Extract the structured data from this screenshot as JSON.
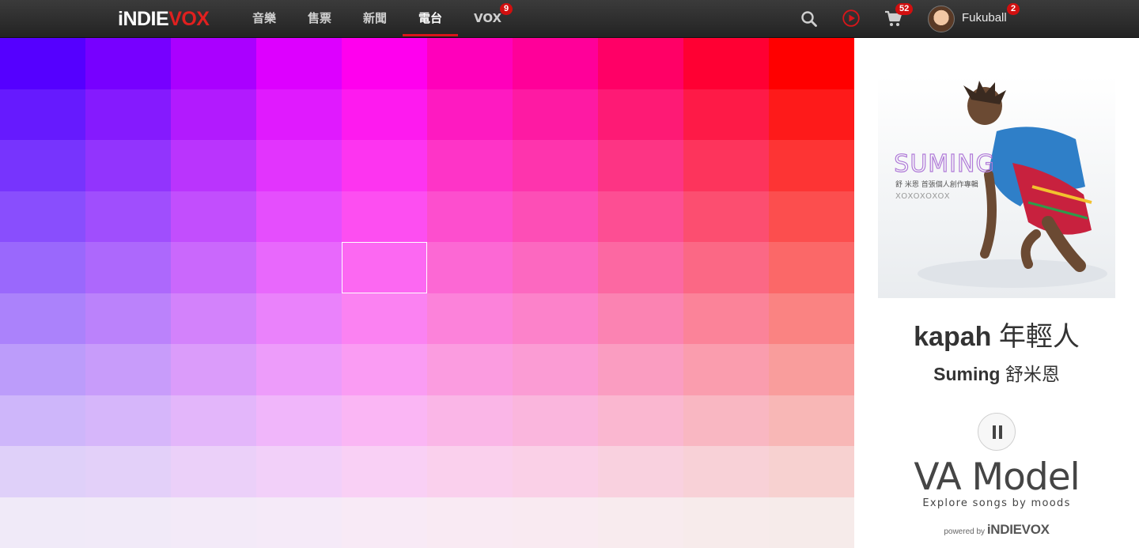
{
  "header": {
    "logo_prefix": "iNDIE",
    "logo_suffix": "VOX",
    "nav": [
      {
        "label": "音樂",
        "active": false
      },
      {
        "label": "售票",
        "active": false
      },
      {
        "label": "新聞",
        "active": false
      },
      {
        "label": "電台",
        "active": true
      },
      {
        "label": "VOX",
        "active": false,
        "badge": "9"
      }
    ],
    "icons": [
      "search-icon",
      "play-circle-icon",
      "cart-icon"
    ],
    "cart_badge": "52",
    "user": {
      "name": "Fukuball",
      "badge": "2"
    },
    "accent_color": "#d9161a"
  },
  "mood_grid": {
    "columns": 10,
    "rows": 10,
    "selected_cell": {
      "row": 4,
      "col": 4
    },
    "top_row_colors": [
      "#5500ff",
      "#7700ff",
      "#aa00ff",
      "#dd00ff",
      "#ff00ee",
      "#ff00bb",
      "#ff0099",
      "#ff0066",
      "#ff0033",
      "#ff0000"
    ],
    "bottom_row_colors": [
      "#f0eaf8",
      "#f1eaf8",
      "#f3eaf8",
      "#f5eaf8",
      "#f8eaf6",
      "#f9eaf3",
      "#f9eaf1",
      "#f8ebee",
      "#f7ebeb",
      "#f6ebea"
    ]
  },
  "now_playing": {
    "cover_text": "SUMING",
    "cover_subtext": "舒 米恩   首張個人創作專輯",
    "title_latin": "kapah",
    "title_cjk": "年輕人",
    "artist_latin": "Suming",
    "artist_cjk": "舒米恩",
    "state": "playing"
  },
  "branding": {
    "title": "VA Model",
    "subtitle": "Explore songs by moods",
    "powered_by": "powered by",
    "powered_brand_prefix": "iNDIE",
    "powered_brand_suffix": "VOX"
  }
}
